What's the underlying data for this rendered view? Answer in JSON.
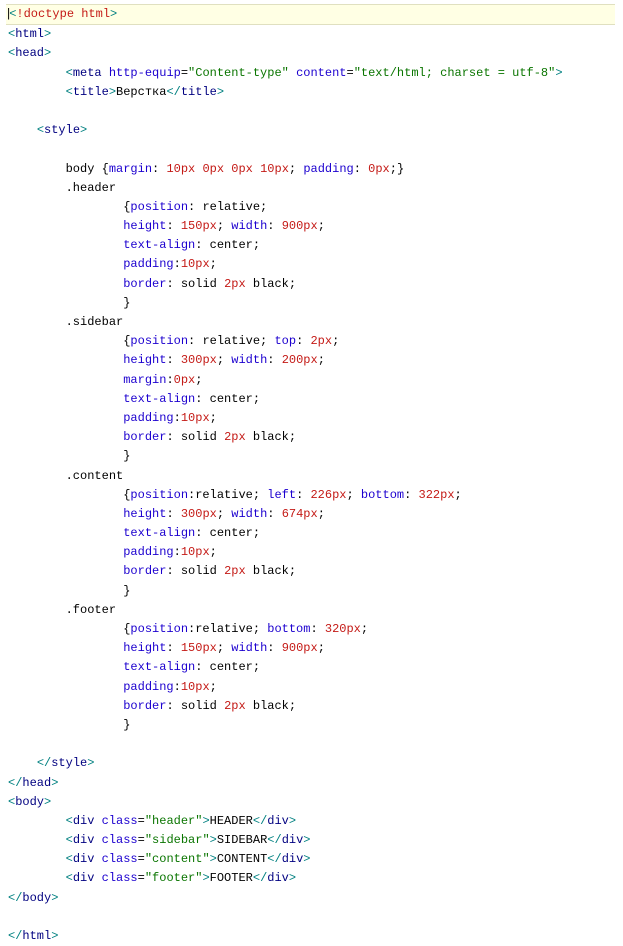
{
  "lines": {
    "l01_doctype": "<!doctype html>",
    "l02_html_open": "<html>",
    "l03_head_open": "<head>",
    "l04_meta": "        <meta http-equip=\"Content-type\" content=\"text/html; charset = utf-8\">",
    "l05_title": "        <title>Верстка</title>",
    "l06_blank": "",
    "l07_style_open": "    <style>",
    "l08_blank": "",
    "l09_body_rule": "        body {margin: 10px 0px 0px 10px; padding: 0px;}",
    "l10_header_sel": "        .header",
    "l11_header_b1": "                {position: relative;",
    "l12_header_b2": "                height: 150px; width: 900px;",
    "l13_header_b3": "                text-align: center;",
    "l14_header_b4": "                padding:10px;",
    "l15_header_b5": "                border: solid 2px black;",
    "l16_header_b6": "                }",
    "l17_sidebar_sel": "        .sidebar",
    "l18_sidebar_b1": "                {position: relative; top: 2px;",
    "l19_sidebar_b2": "                height: 300px; width: 200px;",
    "l20_sidebar_b3": "                margin:0px;",
    "l21_sidebar_b4": "                text-align: center;",
    "l22_sidebar_b5": "                padding:10px;",
    "l23_sidebar_b6": "                border: solid 2px black;",
    "l24_sidebar_b7": "                }",
    "l25_content_sel": "        .content",
    "l26_content_b1": "                {position:relative; left: 226px; bottom: 322px;",
    "l27_content_b2": "                height: 300px; width: 674px;",
    "l28_content_b3": "                text-align: center;",
    "l29_content_b4": "                padding:10px;",
    "l30_content_b5": "                border: solid 2px black;",
    "l31_content_b6": "                }",
    "l32_footer_sel": "        .footer",
    "l33_footer_b1": "                {position:relative; bottom: 320px;",
    "l34_footer_b2": "                height: 150px; width: 900px;",
    "l35_footer_b3": "                text-align: center;",
    "l36_footer_b4": "                padding:10px;",
    "l37_footer_b5": "                border: solid 2px black;",
    "l38_footer_b6": "                }",
    "l39_blank": "",
    "l40_style_close": "    </style>",
    "l41_head_close": "</head>",
    "l42_body_open": "<body>",
    "l43_div_header": "        <div class=\"header\">HEADER</div>",
    "l44_div_sidebar": "        <div class=\"sidebar\">SIDEBAR</div>",
    "l45_div_content": "        <div class=\"content\">CONTENT</div>",
    "l46_div_footer": "        <div class=\"footer\">FOOTER</div>",
    "l47_body_close": "</body>",
    "l48_blank": "",
    "l49_html_close": "</html>"
  }
}
